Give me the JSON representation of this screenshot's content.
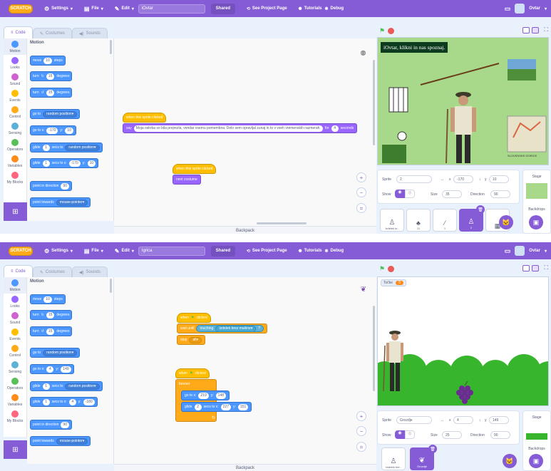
{
  "shared": {
    "logo": "SCRATCH",
    "settings": "Settings",
    "file": "File",
    "edit": "Edit",
    "shared_btn": "Shared",
    "see_project": "See Project Page",
    "tutorials": "Tutorials",
    "debug": "Debug",
    "user": "Ovtar",
    "tab_code": "Code",
    "tab_costumes": "Costumes",
    "tab_sounds": "Sounds",
    "categories": [
      "Motion",
      "Looks",
      "Sound",
      "Events",
      "Control",
      "Sensing",
      "Operators",
      "Variables",
      "My Blocks"
    ],
    "category_colors": [
      "#4c97ff",
      "#9966ff",
      "#cf63cf",
      "#ffbf00",
      "#ffab19",
      "#5cb1d6",
      "#59c059",
      "#ff8c1a",
      "#ff6680"
    ],
    "palette_heading": "Motion",
    "palette": {
      "move": "move",
      "steps": "steps",
      "steps_val": "10",
      "turn": "turn",
      "degrees": "degrees",
      "turn_val": "15",
      "goto": "go to",
      "random_pos": "random position",
      "goto_x": "go to x:",
      "y": "y:",
      "glide": "glide",
      "secs_to": "secs to",
      "secs_to_x": "secs to x:",
      "glide_val": "1",
      "point_dir": "point in direction",
      "dir_val": "90",
      "point_towards": "point towards",
      "mouse_pointer": "mouse-pointer"
    },
    "backpack": "Backpack",
    "sprite_label": "Sprite",
    "show_label": "Show",
    "size_label": "Size",
    "direction_label": "Direction",
    "stage_label": "Stage",
    "backdrops_label": "Backdrops",
    "x_label": "x",
    "y_label": "y"
  },
  "editor1": {
    "project_title": "iOvtar",
    "goto_x": "-170",
    "goto_y": "10",
    "glide_x": "-170",
    "glide_y": "10",
    "script1_hat": "when this sprite clicked",
    "script1_say": "say",
    "script1_text": "Moja oskrba so bila prejrezla, vendar vsemu pomembna. Delo sem opravljal zunaj in to v vseh vremenskih razmerah.",
    "script1_for": "for",
    "script1_secs": "4",
    "script1_secs_label": "seconds",
    "script2_hat": "when this sprite clicked",
    "script2_block": "next costume",
    "stage_title": "iOvtar, klikni in nas spoznaj.",
    "map_caption": "SLOVENSKE GORICE",
    "sprite_name": "2",
    "sprite_x": "-170",
    "sprite_y": "10",
    "sprite_size": "35",
    "sprite_dir": "90",
    "thumbs": [
      "Izdelek kr..",
      "11",
      "1",
      "2",
      ""
    ]
  },
  "editor2": {
    "project_title": "Igrica",
    "goto_x": "4",
    "goto_y": "149",
    "glide_x": "4",
    "glide_y": "-180",
    "s1_hat": "when",
    "s1_hat_tail": "clicked",
    "s1_wait": "wait until",
    "s1_touching": "touching",
    "s1_target": "Izdelek brez mašine",
    "s1_stop": "stop",
    "s1_all": "all",
    "s2_hat": "when",
    "s2_hat_tail": "clicked",
    "s2_forever": "forever",
    "s2_goto": "go to x:",
    "s2_gx": "219",
    "s2_gy": "148",
    "s2_glide": "glide",
    "s2_secs": "2",
    "s2_secs_to": "secs to x:",
    "s2_lx": "227",
    "s2_ly": "151",
    "var_label": "Točke",
    "var_val": "0",
    "sprite_name": "Grozdje",
    "sprite_x": "4",
    "sprite_y": "149",
    "sprite_size": "25",
    "sprite_dir": "90",
    "thumbs": [
      "Izdelek bre..",
      "Grozdje"
    ]
  }
}
